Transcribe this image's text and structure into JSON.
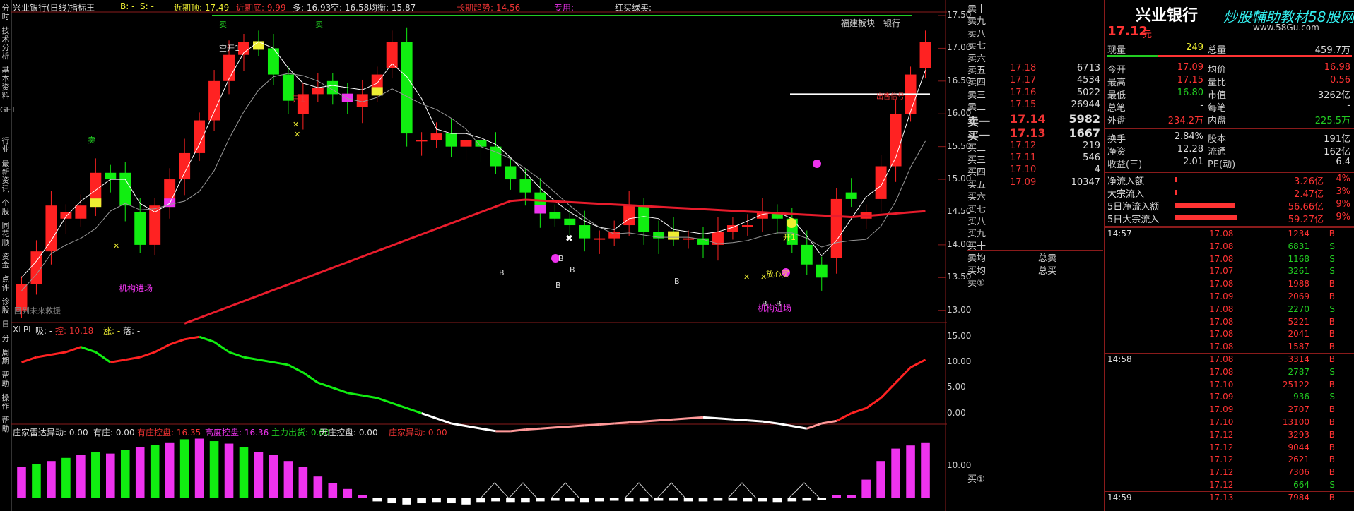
{
  "main_header": {
    "title": "兴业银行(日线)",
    "indicator": "指标王",
    "b_label": "B: -",
    "s_label": "S: -",
    "near_top": "近期顶: 17.49",
    "near_bottom": "近期底: 9.99",
    "duo": "多: 16.93",
    "kong": "空: 16.58",
    "junxian": "均衡: 15.87",
    "trend": "长期趋势: 14.56",
    "special": "专用: -",
    "redbuy": "红买绿卖: -"
  },
  "main_annotations": {
    "sector": "福建板块",
    "industry": "银行",
    "inst_in1": "机构进场",
    "inst_in2": "机构进场",
    "reach_future": "回到未来救援",
    "sell1": "卖",
    "sell2": "卖",
    "sell3": "卖",
    "kongkai": "空开1",
    "kai1": "开1",
    "kai2": "开1",
    "dingxin": "放心买",
    "crash": "出售信号",
    "b_marks": [
      "B",
      "B",
      "B",
      "B",
      "B",
      "B",
      "B"
    ]
  },
  "price_axis": [
    "17.50",
    "17.00",
    "16.50",
    "16.00",
    "15.50",
    "15.00",
    "14.50",
    "14.00",
    "13.50",
    "13.00"
  ],
  "sub1_header": {
    "name": "XLPL",
    "xi": "吸: -",
    "kong": "控: 10.18",
    "zhang": "涨: -",
    "luo": "落: -"
  },
  "sub1_axis": [
    "15.00",
    "10.00",
    "5.00",
    "0.00"
  ],
  "sub2_header": {
    "name": "庄家雷达",
    "yidong": "异动: 0.00",
    "youzhuang": "有庄: 0.00",
    "youzhuangkong": "有庄控盘: 16.35",
    "gaodu": "高度控盘: 16.36",
    "zhuli": "主力出货: 0.00",
    "wuzhuang": "无庄控盘: 0.00",
    "yidong2": "庄家异动: 0.00"
  },
  "sub2_axis": [
    "10.00"
  ],
  "left_tabs": [
    "分时",
    "技术分析",
    "基本资料",
    "GET",
    "行业",
    "最新资讯",
    "个股",
    "同花顺",
    "资金",
    "点评",
    "诊股",
    "日",
    "分",
    "周期",
    "帮助",
    "操作",
    "帮助"
  ],
  "orderbook": {
    "sells": [
      {
        "label": "卖十",
        "price": "",
        "vol": ""
      },
      {
        "label": "卖九",
        "price": "",
        "vol": ""
      },
      {
        "label": "卖八",
        "price": "",
        "vol": ""
      },
      {
        "label": "卖七",
        "price": "",
        "vol": ""
      },
      {
        "label": "卖六",
        "price": "",
        "vol": ""
      },
      {
        "label": "卖五",
        "price": "17.18",
        "vol": "6713"
      },
      {
        "label": "卖四",
        "price": "17.17",
        "vol": "4534"
      },
      {
        "label": "卖三",
        "price": "17.16",
        "vol": "5022"
      },
      {
        "label": "卖二",
        "price": "17.15",
        "vol": "26944"
      },
      {
        "label": "卖一",
        "price": "17.14",
        "vol": "5982"
      }
    ],
    "buys": [
      {
        "label": "买一",
        "price": "17.13",
        "vol": "1667"
      },
      {
        "label": "买二",
        "price": "17.12",
        "vol": "219"
      },
      {
        "label": "买三",
        "price": "17.11",
        "vol": "546"
      },
      {
        "label": "买四",
        "price": "17.10",
        "vol": "4"
      },
      {
        "label": "买五",
        "price": "17.09",
        "vol": "10347"
      },
      {
        "label": "买六",
        "price": "",
        "vol": ""
      },
      {
        "label": "买七",
        "price": "",
        "vol": ""
      },
      {
        "label": "买八",
        "price": "",
        "vol": ""
      },
      {
        "label": "买九",
        "price": "",
        "vol": ""
      },
      {
        "label": "买十",
        "price": "",
        "vol": ""
      }
    ],
    "maijun": "卖均",
    "mai_jun": "买均",
    "zongmai": "总卖",
    "zongmai2": "总买",
    "sell_circle": "卖①",
    "buy_circle": "买①"
  },
  "info": {
    "name": "兴业银行",
    "watermark": "炒股輔助教材58股网",
    "watermark_url": "www.58Gu.com",
    "price": "17.12",
    "unit": "元",
    "rows": [
      [
        "现量",
        "249",
        "总量",
        "459.7万"
      ],
      [
        "今开",
        "17.09",
        "均价",
        "16.98"
      ],
      [
        "最高",
        "17.15",
        "量比",
        "0.56"
      ],
      [
        "最低",
        "16.80",
        "市值",
        "3262亿"
      ],
      [
        "总笔",
        "-",
        "每笔",
        "-"
      ],
      [
        "外盘",
        "234.2万",
        "内盘",
        "225.5万"
      ],
      [
        "换手",
        "2.84%",
        "股本",
        "191亿"
      ],
      [
        "净资",
        "12.28",
        "流通",
        "162亿"
      ],
      [
        "收益(三)",
        "2.01",
        "PE(动)",
        "6.4"
      ]
    ],
    "flows": [
      {
        "label": "净流入额",
        "value": "3.26亿",
        "pct": "4%",
        "bar": 0.02
      },
      {
        "label": "大宗流入",
        "value": "2.47亿",
        "pct": "3%",
        "bar": 0.02
      },
      {
        "label": "5日净流入额",
        "value": "56.66亿",
        "pct": "9%",
        "bar": 0.6
      },
      {
        "label": "5日大宗流入",
        "value": "59.27亿",
        "pct": "9%",
        "bar": 0.62
      }
    ],
    "ticks": [
      [
        "14:57",
        "17.08",
        "1234",
        "B"
      ],
      [
        "",
        "17.08",
        "6831",
        "S"
      ],
      [
        "",
        "17.08",
        "1168",
        "S"
      ],
      [
        "",
        "17.07",
        "3261",
        "S"
      ],
      [
        "",
        "17.08",
        "1988",
        "B"
      ],
      [
        "",
        "17.09",
        "2069",
        "B"
      ],
      [
        "",
        "17.08",
        "2270",
        "S"
      ],
      [
        "",
        "17.08",
        "5221",
        "B"
      ],
      [
        "",
        "17.08",
        "2041",
        "B"
      ],
      [
        "",
        "17.08",
        "1587",
        "B"
      ],
      [
        "14:58",
        "17.08",
        "3314",
        "B"
      ],
      [
        "",
        "17.08",
        "2787",
        "S"
      ],
      [
        "",
        "17.10",
        "25122",
        "B"
      ],
      [
        "",
        "17.09",
        "936",
        "S"
      ],
      [
        "",
        "17.09",
        "2707",
        "B"
      ],
      [
        "",
        "17.10",
        "13100",
        "B"
      ],
      [
        "",
        "17.12",
        "3293",
        "B"
      ],
      [
        "",
        "17.12",
        "9044",
        "B"
      ],
      [
        "",
        "17.12",
        "2621",
        "B"
      ],
      [
        "",
        "17.12",
        "7306",
        "B"
      ],
      [
        "",
        "17.12",
        "664",
        "S"
      ],
      [
        "14:59",
        "17.13",
        "7984",
        "B"
      ]
    ]
  },
  "colors": {
    "up": "#ff2222",
    "down": "#11ee11",
    "ma": "#ffffff",
    "long": "#e81c2c",
    "mag": "#ee33ee"
  }
}
